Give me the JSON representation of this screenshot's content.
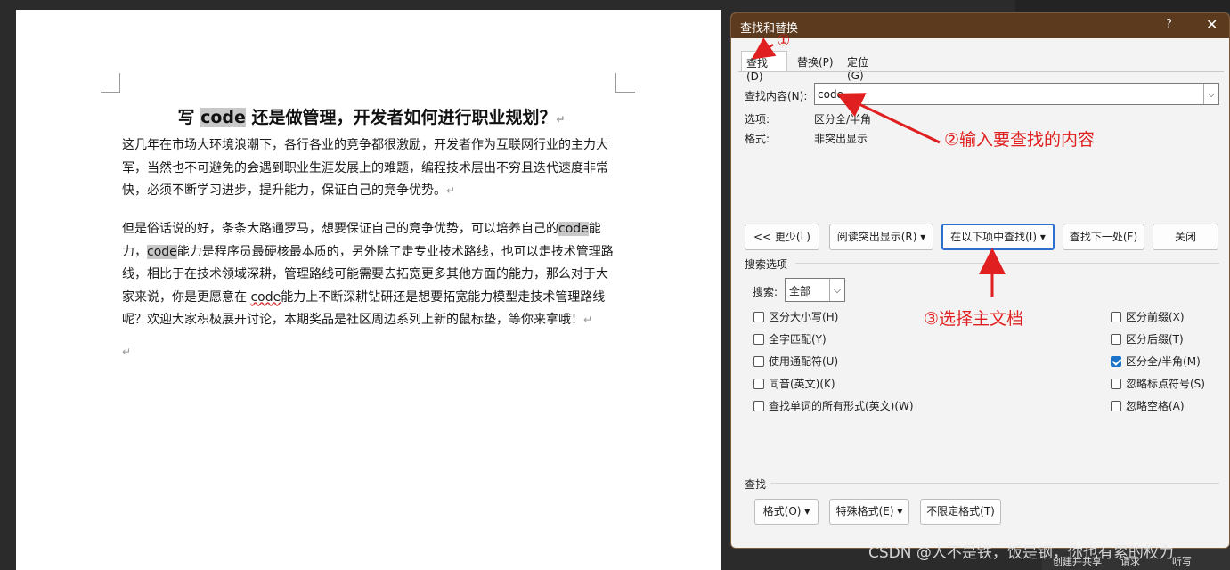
{
  "document": {
    "title_pre": "写 ",
    "title_code": "code",
    "title_post": " 还是做管理，开发者如何进行职业规划？",
    "para_mark": "↵",
    "para1": "这几年在市场大环境浪潮下，各行各业的竞争都很激励，开发者作为互联网行业的主力大军，当然也不可避免的会遇到职业生涯发展上的难题，编程技术层出不穷且迭代速度非常快，必须不断学习进步，提升能力，保证自己的竞争优势。",
    "para2_a": "但是俗话说的好，条条大路通罗马，想要保证自己的竞争优势，可以培养自己的",
    "code1": "code",
    "para2_b": "能力，",
    "code2": "code",
    "para2_c": "能力是程序员最硬核最本质的，另外除了走专业技术路线，也可以走技术管理路线，相比于在技术领域深耕，管理路线可能需要去拓宽更多其他方面的能力，那么对于大家来说，你是更愿意在 ",
    "code3": "code",
    "para2_d": "能力上不断深耕钻研还是想要拓宽能力模型走技术管理路线呢？欢迎大家积极展开讨论，本期奖品是社区周边系列上新的鼠标垫，等你来拿哦！"
  },
  "dialog": {
    "title": "查找和替换",
    "help": "?",
    "close": "✕",
    "tabs": {
      "find": "查找(D)",
      "replace": "替换(P)",
      "goto": "定位(G)"
    },
    "find_label": "查找内容(N):",
    "find_value": "code",
    "options_label": "选项:",
    "options_value": "区分全/半角",
    "format_label": "格式:",
    "format_value": "非突出显示",
    "buttons": {
      "less": "<< 更少(L)",
      "highlight": "阅读突出显示(R) ▾",
      "find_in": "在以下项中查找(I) ▾",
      "find_next": "查找下一处(F)",
      "close": "关闭"
    },
    "search_options_label": "搜索选项",
    "search_label": "搜索:",
    "search_value": "全部",
    "checkboxes_left": [
      {
        "label": "区分大小写(H)",
        "checked": false
      },
      {
        "label": "全字匹配(Y)",
        "checked": false
      },
      {
        "label": "使用通配符(U)",
        "checked": false
      },
      {
        "label": "同音(英文)(K)",
        "checked": false
      },
      {
        "label": "查找单词的所有形式(英文)(W)",
        "checked": false
      }
    ],
    "checkboxes_right": [
      {
        "label": "区分前缀(X)",
        "checked": false
      },
      {
        "label": "区分后缀(T)",
        "checked": false
      },
      {
        "label": "区分全/半角(M)",
        "checked": true
      },
      {
        "label": "忽略标点符号(S)",
        "checked": false
      },
      {
        "label": "忽略空格(A)",
        "checked": false
      }
    ],
    "find_section_label": "查找",
    "bottom_buttons": {
      "format": "格式(O) ▾",
      "special": "特殊格式(E) ▾",
      "no_format": "不限定格式(T)"
    }
  },
  "annotations": {
    "a1": "①",
    "a2": "②输入要查找的内容",
    "a3": "③选择主文档"
  },
  "bottom_bar": {
    "share": "创建并共享",
    "request": "请求",
    "listen": "听写"
  },
  "watermark": "CSDN @人不是铁，饭是钢，你也有累的权力",
  "colors": {
    "titlebar": "#5c3a1e",
    "annotation": "#e02020",
    "checkbox_on": "#1a73c9"
  }
}
